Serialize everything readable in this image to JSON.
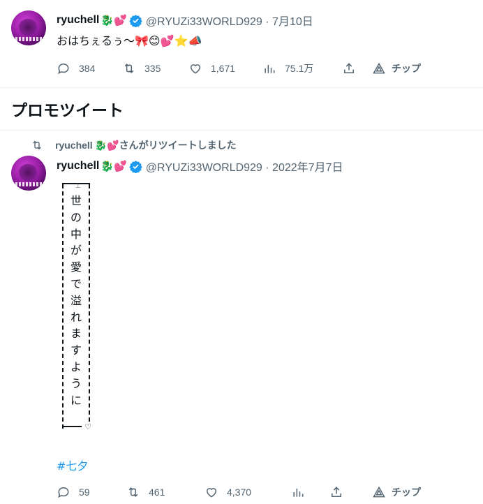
{
  "tweet1": {
    "display_name": "ryuchell",
    "name_emoji": "🐉💕",
    "handle_date": "@RYUZi33WORLD929 · 7月10日",
    "text": "おはちぇるぅ～🎀😊💕⭐📣",
    "replies": "384",
    "retweets": "335",
    "likes": "1,671",
    "views": "75.1万",
    "tip_label": "チップ"
  },
  "section": {
    "title": "プロモツイート"
  },
  "retweet_context": {
    "name": "ryuchell",
    "emoji": "🐉💕",
    "label": "さんがリツイートしました"
  },
  "tweet2": {
    "display_name": "ryuchell",
    "name_emoji": "🐉💕",
    "handle_date": "@RYUZi33WORLD929 · 2022年7月7日",
    "vertical_chars": [
      "世",
      "の",
      "中",
      "が",
      "愛",
      "で",
      "溢",
      "れ",
      "ま",
      "す",
      "よ",
      "う",
      "に"
    ],
    "tick_mark": "⊥",
    "heart": "♡",
    "hashtag": "#七夕",
    "replies": "59",
    "retweets": "461",
    "likes": "4,370",
    "tip_label": "チップ"
  },
  "colors": {
    "accent": "#1d9bf0",
    "secondary_text": "#536471",
    "primary_text": "#0f1419",
    "divider": "#eff3f4"
  }
}
